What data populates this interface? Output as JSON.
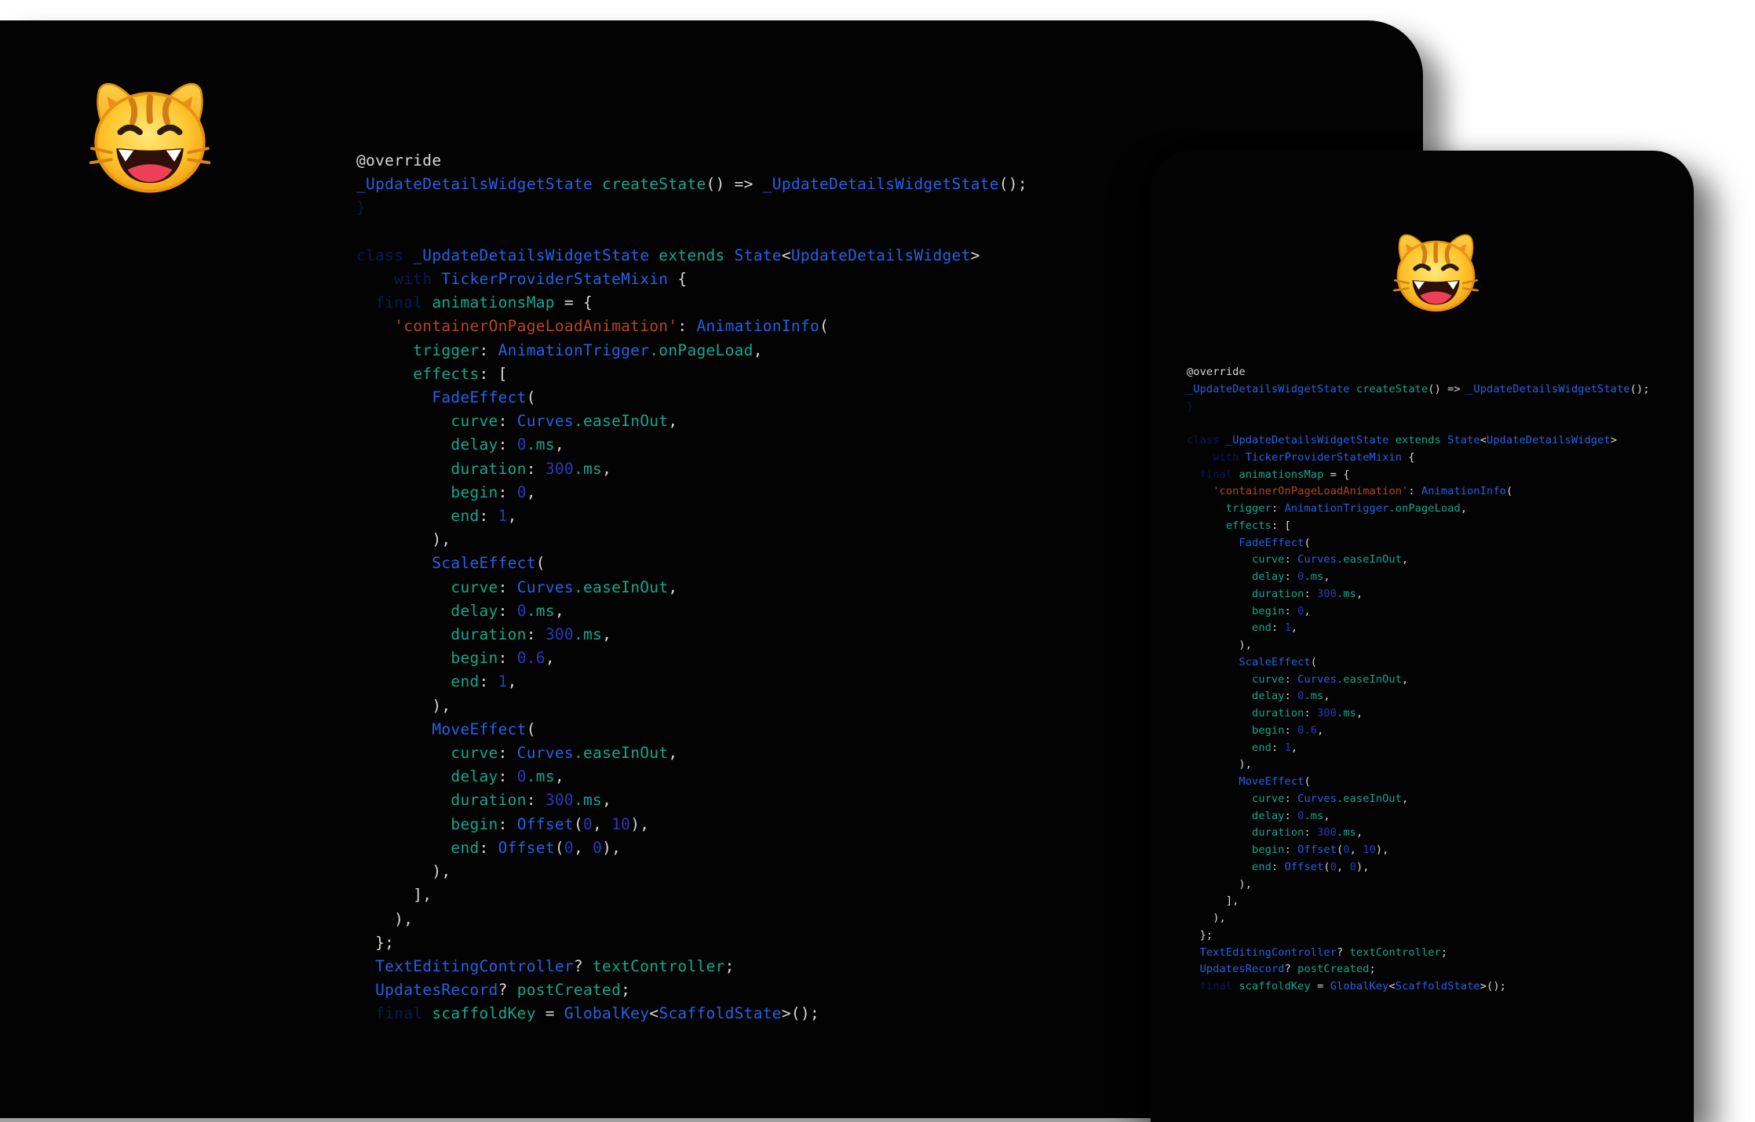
{
  "colors": {
    "background": "#ffffff",
    "panel": "#030303",
    "plain": "#d9d9d9",
    "keyword": "#071a59",
    "type": "#2362e8",
    "identifier": "#11a88e",
    "string": "#b8451f",
    "number": "#2d38ba",
    "brace": "#0a1b3a",
    "muted": "#1c1f27"
  },
  "decor": {
    "back_cat_icon": "grinning-cat-icon",
    "front_cat_icon": "grinning-cat-icon"
  },
  "code_lines": [
    [
      {
        "text": "@override",
        "color": "#d9d9d9"
      }
    ],
    [
      {
        "text": "_UpdateDetailsWidgetState",
        "color": "#2362e8"
      },
      {
        "text": " createState",
        "color": "#11a88e"
      },
      {
        "text": "()",
        "color": "#d9d9d9"
      },
      {
        "text": " =>",
        "color": "#d9d9d9"
      },
      {
        "text": " _UpdateDetailsWidgetState",
        "color": "#2362e8"
      },
      {
        "text": "();",
        "color": "#d9d9d9"
      }
    ],
    [
      {
        "text": "}",
        "color": "#0a1b3a"
      }
    ],
    [],
    [
      {
        "text": "class",
        "color": "#071a59"
      },
      {
        "text": " _UpdateDetailsWidgetState",
        "color": "#2362e8"
      },
      {
        "text": " extends",
        "color": "#11a88e"
      },
      {
        "text": " State",
        "color": "#2362e8"
      },
      {
        "text": "<",
        "color": "#d9d9d9"
      },
      {
        "text": "UpdateDetailsWidget",
        "color": "#2362e8"
      },
      {
        "text": ">",
        "color": "#d9d9d9"
      }
    ],
    [
      {
        "text": "    with",
        "color": "#071a59"
      },
      {
        "text": " TickerProviderStateMixin",
        "color": "#2362e8"
      },
      {
        "text": " {",
        "color": "#d9d9d9"
      }
    ],
    [
      {
        "text": "  final",
        "color": "#071a59"
      },
      {
        "text": " animationsMap",
        "color": "#11a88e"
      },
      {
        "text": " = {",
        "color": "#d9d9d9"
      }
    ],
    [
      {
        "text": "    '",
        "color": "#b8451f"
      },
      {
        "text": "containerOnPageLoadAnimation",
        "color": "#b8451f"
      },
      {
        "text": "'",
        "color": "#b8451f"
      },
      {
        "text": ": ",
        "color": "#d9d9d9"
      },
      {
        "text": "AnimationInfo",
        "color": "#2362e8"
      },
      {
        "text": "(",
        "color": "#d9d9d9"
      }
    ],
    [
      {
        "text": "      trigger",
        "color": "#11a88e"
      },
      {
        "text": ": ",
        "color": "#d9d9d9"
      },
      {
        "text": "AnimationTrigger",
        "color": "#2362e8"
      },
      {
        "text": ".onPageLoad",
        "color": "#11a88e"
      },
      {
        "text": ",",
        "color": "#d9d9d9"
      }
    ],
    [
      {
        "text": "      effects",
        "color": "#11a88e"
      },
      {
        "text": ": [",
        "color": "#d9d9d9"
      }
    ],
    [
      {
        "text": "        FadeEffect",
        "color": "#2362e8"
      },
      {
        "text": "(",
        "color": "#d9d9d9"
      }
    ],
    [
      {
        "text": "          curve",
        "color": "#11a88e"
      },
      {
        "text": ": ",
        "color": "#d9d9d9"
      },
      {
        "text": "Curves",
        "color": "#2362e8"
      },
      {
        "text": ".easeInOut",
        "color": "#11a88e"
      },
      {
        "text": ",",
        "color": "#d9d9d9"
      }
    ],
    [
      {
        "text": "          delay",
        "color": "#11a88e"
      },
      {
        "text": ": ",
        "color": "#d9d9d9"
      },
      {
        "text": "0",
        "color": "#2d38ba"
      },
      {
        "text": ".ms",
        "color": "#11a88e"
      },
      {
        "text": ",",
        "color": "#d9d9d9"
      }
    ],
    [
      {
        "text": "          duration",
        "color": "#11a88e"
      },
      {
        "text": ": ",
        "color": "#d9d9d9"
      },
      {
        "text": "300",
        "color": "#2d38ba"
      },
      {
        "text": ".ms",
        "color": "#11a88e"
      },
      {
        "text": ",",
        "color": "#d9d9d9"
      }
    ],
    [
      {
        "text": "          begin",
        "color": "#11a88e"
      },
      {
        "text": ": ",
        "color": "#d9d9d9"
      },
      {
        "text": "0",
        "color": "#2d38ba"
      },
      {
        "text": ",",
        "color": "#d9d9d9"
      }
    ],
    [
      {
        "text": "          end",
        "color": "#11a88e"
      },
      {
        "text": ": ",
        "color": "#d9d9d9"
      },
      {
        "text": "1",
        "color": "#2d38ba"
      },
      {
        "text": ",",
        "color": "#d9d9d9"
      }
    ],
    [
      {
        "text": "        ),",
        "color": "#d9d9d9"
      }
    ],
    [
      {
        "text": "        ScaleEffect",
        "color": "#2362e8"
      },
      {
        "text": "(",
        "color": "#d9d9d9"
      }
    ],
    [
      {
        "text": "          curve",
        "color": "#11a88e"
      },
      {
        "text": ": ",
        "color": "#d9d9d9"
      },
      {
        "text": "Curves",
        "color": "#2362e8"
      },
      {
        "text": ".easeInOut",
        "color": "#11a88e"
      },
      {
        "text": ",",
        "color": "#d9d9d9"
      }
    ],
    [
      {
        "text": "          delay",
        "color": "#11a88e"
      },
      {
        "text": ": ",
        "color": "#d9d9d9"
      },
      {
        "text": "0",
        "color": "#2d38ba"
      },
      {
        "text": ".ms",
        "color": "#11a88e"
      },
      {
        "text": ",",
        "color": "#d9d9d9"
      }
    ],
    [
      {
        "text": "          duration",
        "color": "#11a88e"
      },
      {
        "text": ": ",
        "color": "#d9d9d9"
      },
      {
        "text": "300",
        "color": "#2d38ba"
      },
      {
        "text": ".ms",
        "color": "#11a88e"
      },
      {
        "text": ",",
        "color": "#d9d9d9"
      }
    ],
    [
      {
        "text": "          begin",
        "color": "#11a88e"
      },
      {
        "text": ": ",
        "color": "#d9d9d9"
      },
      {
        "text": "0.6",
        "color": "#2d38ba"
      },
      {
        "text": ",",
        "color": "#d9d9d9"
      }
    ],
    [
      {
        "text": "          end",
        "color": "#11a88e"
      },
      {
        "text": ": ",
        "color": "#d9d9d9"
      },
      {
        "text": "1",
        "color": "#2d38ba"
      },
      {
        "text": ",",
        "color": "#d9d9d9"
      }
    ],
    [
      {
        "text": "        ),",
        "color": "#d9d9d9"
      }
    ],
    [
      {
        "text": "        MoveEffect",
        "color": "#2362e8"
      },
      {
        "text": "(",
        "color": "#d9d9d9"
      }
    ],
    [
      {
        "text": "          curve",
        "color": "#11a88e"
      },
      {
        "text": ": ",
        "color": "#d9d9d9"
      },
      {
        "text": "Curves",
        "color": "#2362e8"
      },
      {
        "text": ".easeInOut",
        "color": "#11a88e"
      },
      {
        "text": ",",
        "color": "#d9d9d9"
      }
    ],
    [
      {
        "text": "          delay",
        "color": "#11a88e"
      },
      {
        "text": ": ",
        "color": "#d9d9d9"
      },
      {
        "text": "0",
        "color": "#2d38ba"
      },
      {
        "text": ".ms",
        "color": "#11a88e"
      },
      {
        "text": ",",
        "color": "#d9d9d9"
      }
    ],
    [
      {
        "text": "          duration",
        "color": "#11a88e"
      },
      {
        "text": ": ",
        "color": "#d9d9d9"
      },
      {
        "text": "300",
        "color": "#2d38ba"
      },
      {
        "text": ".ms",
        "color": "#11a88e"
      },
      {
        "text": ",",
        "color": "#d9d9d9"
      }
    ],
    [
      {
        "text": "          begin",
        "color": "#11a88e"
      },
      {
        "text": ": ",
        "color": "#d9d9d9"
      },
      {
        "text": "Offset",
        "color": "#2362e8"
      },
      {
        "text": "(",
        "color": "#d9d9d9"
      },
      {
        "text": "0",
        "color": "#2d38ba"
      },
      {
        "text": ", ",
        "color": "#d9d9d9"
      },
      {
        "text": "10",
        "color": "#2d38ba"
      },
      {
        "text": "),",
        "color": "#d9d9d9"
      }
    ],
    [
      {
        "text": "          end",
        "color": "#11a88e"
      },
      {
        "text": ": ",
        "color": "#d9d9d9"
      },
      {
        "text": "Offset",
        "color": "#2362e8"
      },
      {
        "text": "(",
        "color": "#d9d9d9"
      },
      {
        "text": "0",
        "color": "#2d38ba"
      },
      {
        "text": ", ",
        "color": "#d9d9d9"
      },
      {
        "text": "0",
        "color": "#2d38ba"
      },
      {
        "text": "),",
        "color": "#d9d9d9"
      }
    ],
    [
      {
        "text": "        ),",
        "color": "#d9d9d9"
      }
    ],
    [
      {
        "text": "      ],",
        "color": "#d9d9d9"
      }
    ],
    [
      {
        "text": "    ),",
        "color": "#d9d9d9"
      }
    ],
    [
      {
        "text": "  };",
        "color": "#d9d9d9"
      }
    ],
    [
      {
        "text": "  TextEditingController",
        "color": "#2362e8"
      },
      {
        "text": "?",
        "color": "#d9d9d9"
      },
      {
        "text": " textController",
        "color": "#11a88e"
      },
      {
        "text": ";",
        "color": "#d9d9d9"
      }
    ],
    [
      {
        "text": "  UpdatesRecord",
        "color": "#2362e8"
      },
      {
        "text": "?",
        "color": "#d9d9d9"
      },
      {
        "text": " postCreated",
        "color": "#11a88e"
      },
      {
        "text": ";",
        "color": "#d9d9d9"
      }
    ],
    [
      {
        "text": "  final",
        "color": "#071a59"
      },
      {
        "text": " scaffoldKey",
        "color": "#11a88e"
      },
      {
        "text": " = ",
        "color": "#d9d9d9"
      },
      {
        "text": "GlobalKey",
        "color": "#2362e8"
      },
      {
        "text": "<",
        "color": "#d9d9d9"
      },
      {
        "text": "ScaffoldState",
        "color": "#2362e8"
      },
      {
        "text": ">();",
        "color": "#d9d9d9"
      }
    ]
  ]
}
